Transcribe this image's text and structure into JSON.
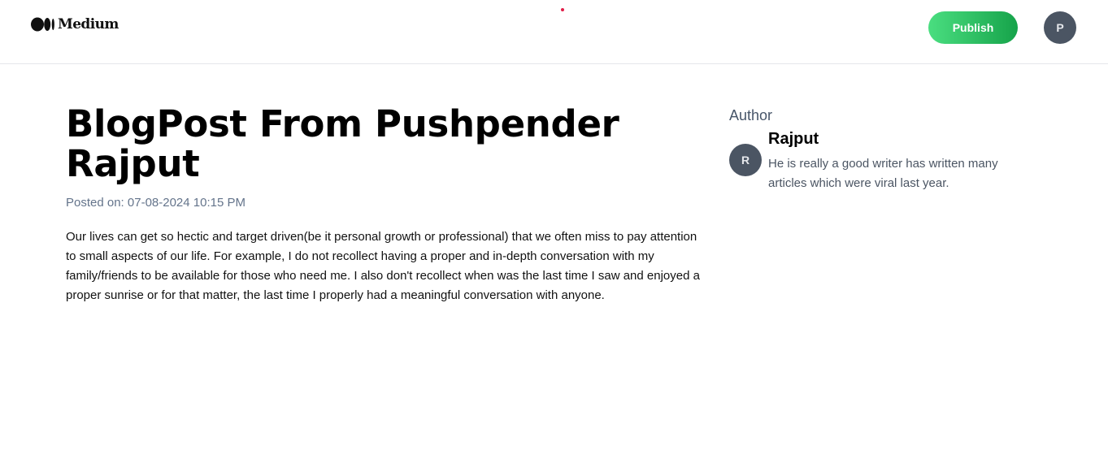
{
  "header": {
    "logo_text": "Medium",
    "publish_label": "Publish",
    "user_initial": "P"
  },
  "article": {
    "title": "BlogPost From Pushpender Rajput",
    "posted_on": "Posted on: 07-08-2024 10:15 PM",
    "content": "Our lives can get so hectic and target driven(be it personal growth or professional) that we often miss to pay attention to small aspects of our life. For example, I do not recollect having a proper and in-depth conversation with my family/friends to be available for those who need me. I also don't recollect when was the last time I saw and enjoyed a proper sunrise or for that matter, the last time I properly had a meaningful conversation with anyone."
  },
  "author": {
    "label": "Author",
    "initial": "R",
    "name": "Rajput",
    "bio": "He is really a good writer has written many articles which were viral last year."
  },
  "colors": {
    "publish_gradient_start": "#4ade80",
    "publish_gradient_end": "#16a34a",
    "avatar_bg": "#4b5563",
    "muted_text": "#64748b"
  }
}
